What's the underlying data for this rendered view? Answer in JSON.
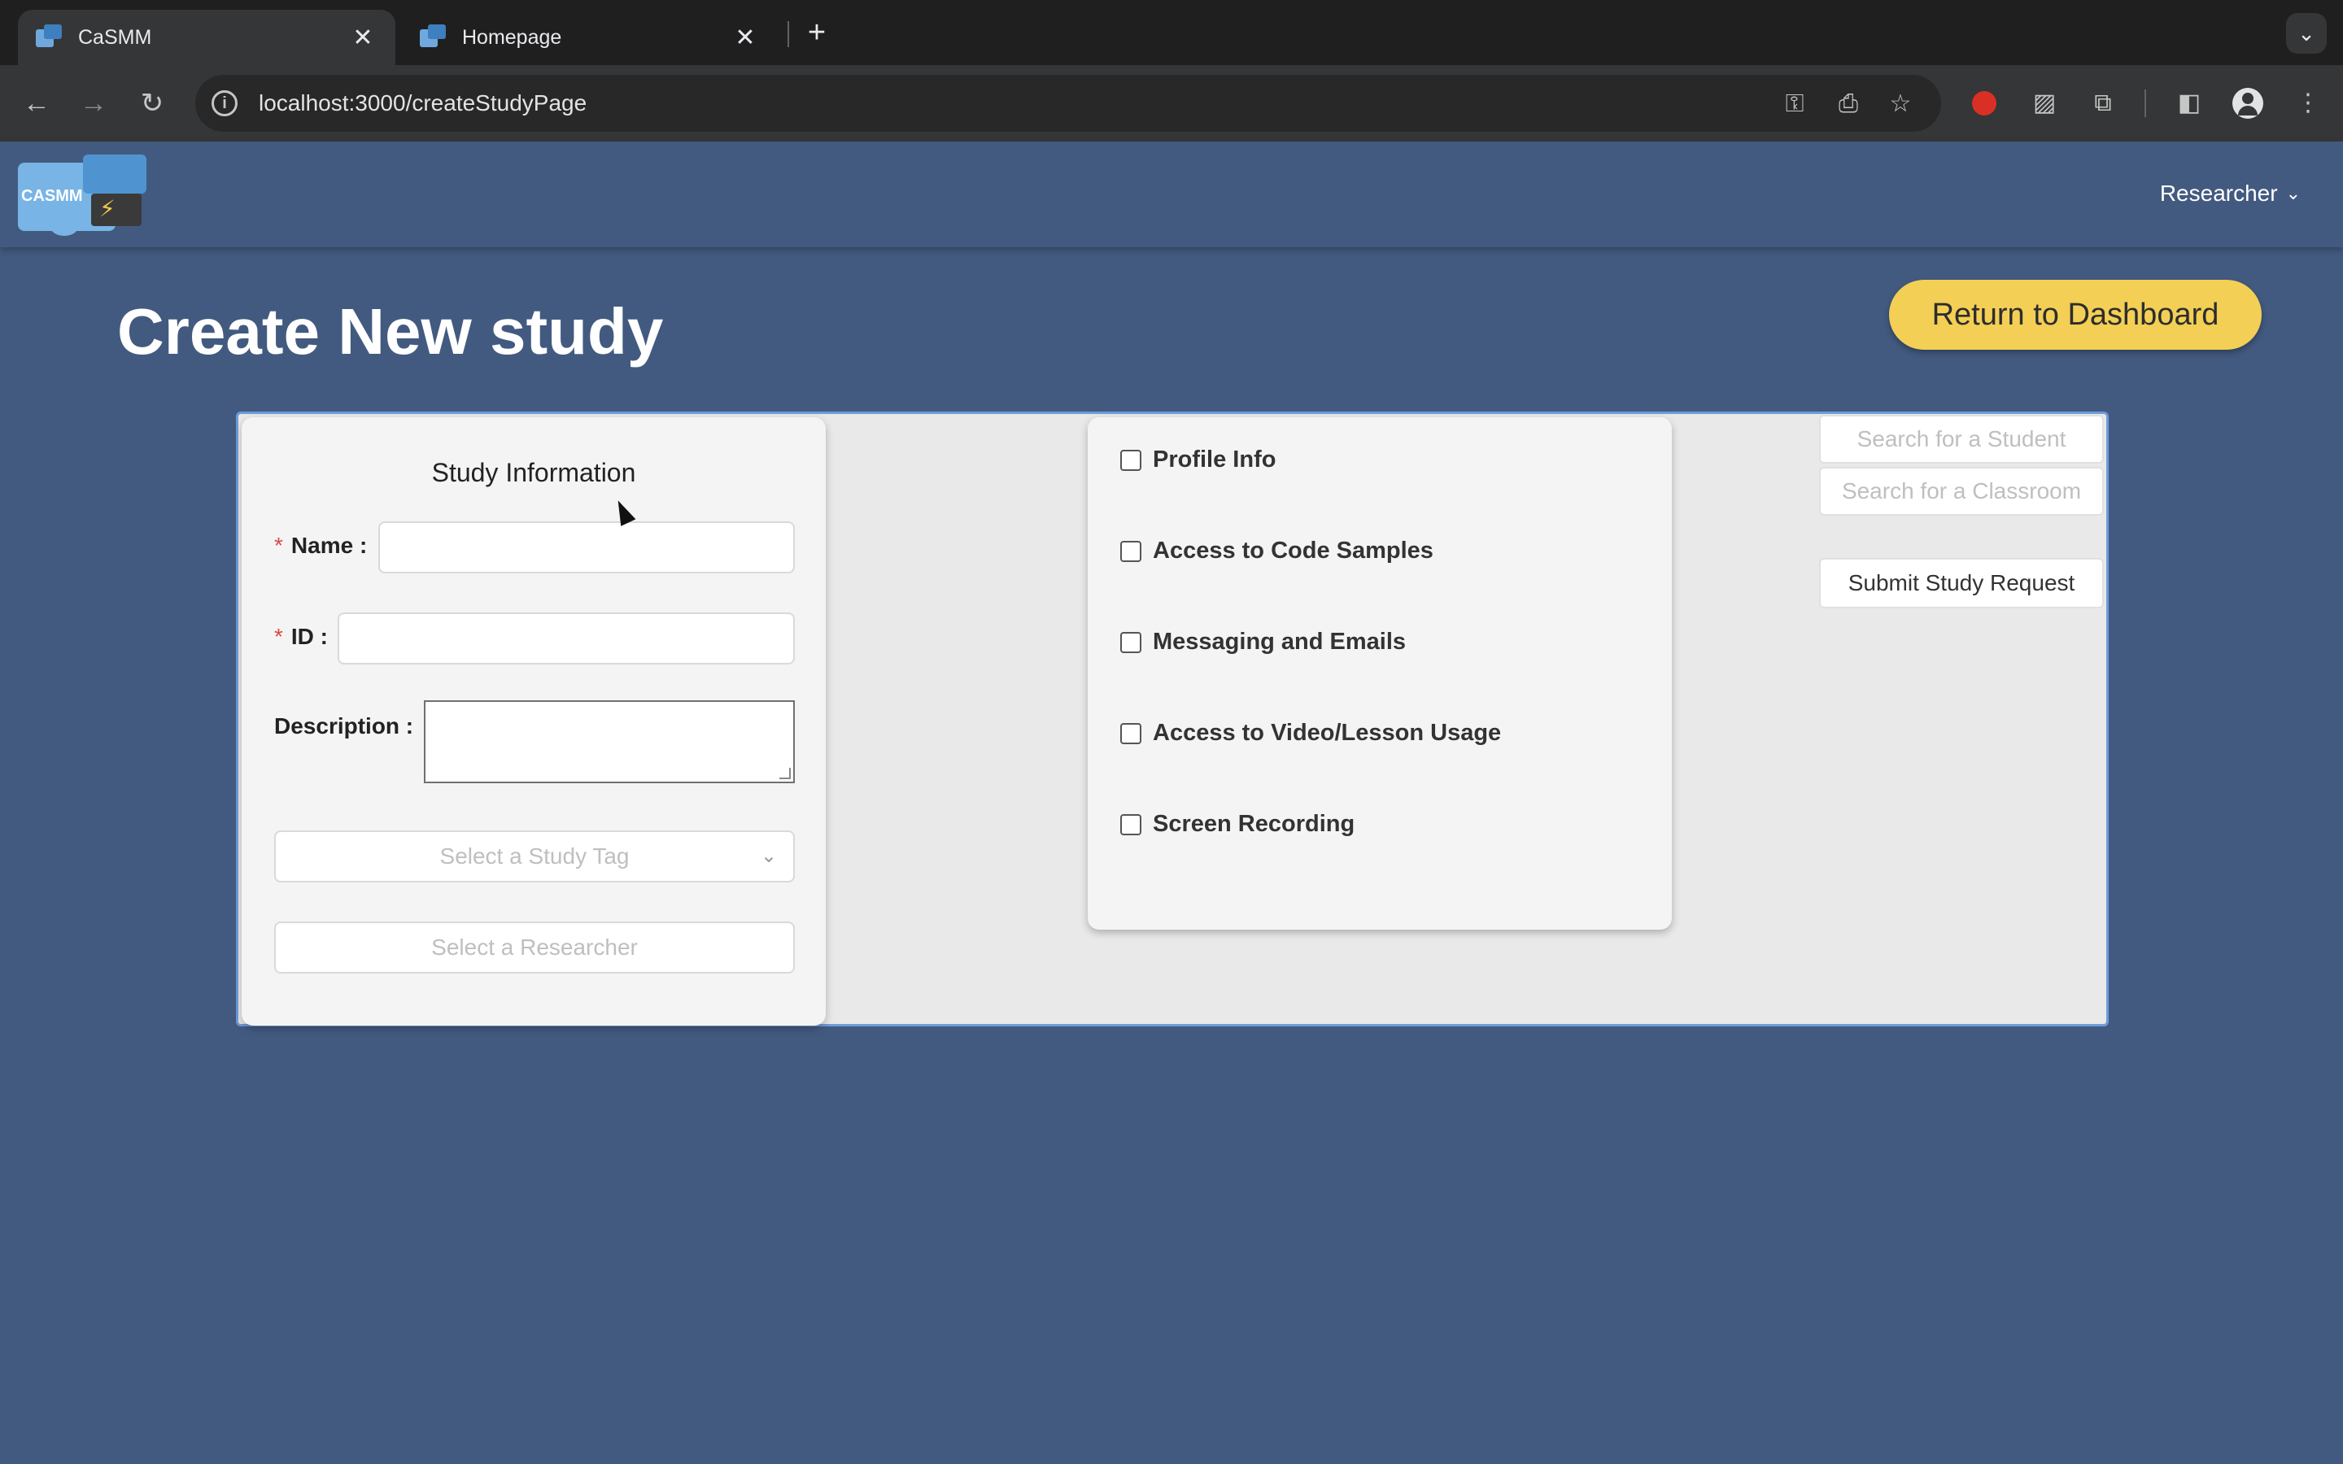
{
  "browser": {
    "tabs": [
      {
        "title": "CaSMM",
        "active": true
      },
      {
        "title": "Homepage",
        "active": false
      }
    ],
    "tab_close_glyph": "✕",
    "new_tab_glyph": "+",
    "url": "localhost:3000/createStudyPage"
  },
  "header": {
    "logo_text": "CASMM",
    "user_menu_label": "Researcher"
  },
  "page": {
    "title": "Create New study",
    "return_button_label": "Return to Dashboard"
  },
  "study_info": {
    "title": "Study Information",
    "name_label": "Name :",
    "id_label": "ID :",
    "description_label": "Description :",
    "required_mark": "*",
    "study_tag_placeholder": "Select a Study Tag",
    "researcher_placeholder": "Select a Researcher"
  },
  "permissions": [
    {
      "label": "Profile Info",
      "checked": false
    },
    {
      "label": "Access to Code Samples",
      "checked": false
    },
    {
      "label": "Messaging and Emails",
      "checked": false
    },
    {
      "label": "Access to Video/Lesson Usage",
      "checked": false
    },
    {
      "label": "Screen Recording",
      "checked": false
    }
  ],
  "side": {
    "student_search_placeholder": "Search for a Student",
    "classroom_search_placeholder": "Search for a Classroom",
    "submit_label": "Submit Study Request"
  },
  "colors": {
    "page_bg": "#435a80",
    "accent_button": "#f3cf55",
    "panel_border": "#6d9bd8",
    "required": "#e04545"
  }
}
